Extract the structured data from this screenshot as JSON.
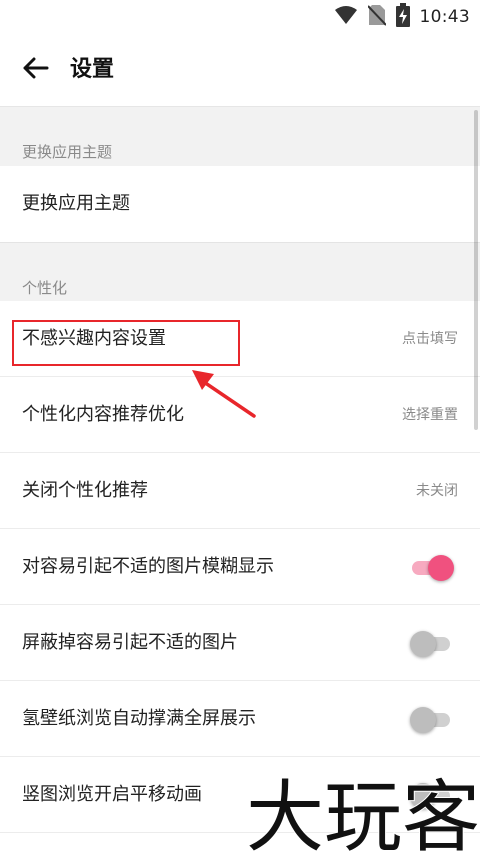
{
  "status_bar": {
    "time": "10:43",
    "icons": [
      "wifi-icon",
      "no-sim-icon",
      "battery-charging-icon"
    ]
  },
  "app_bar": {
    "title": "设置",
    "back_icon": "arrow-left-icon"
  },
  "sections": [
    {
      "header": "更换应用主题",
      "items": [
        {
          "label": "更换应用主题"
        }
      ]
    },
    {
      "header": "个性化",
      "items": [
        {
          "label": "不感兴趣内容设置",
          "value": "点击填写"
        },
        {
          "label": "个性化内容推荐优化",
          "value": "选择重置"
        },
        {
          "label": "关闭个性化推荐",
          "value": "未关闭"
        },
        {
          "label": "对容易引起不适的图片模糊显示",
          "toggle": true
        },
        {
          "label": "屏蔽掉容易引起不适的图片",
          "toggle": false
        },
        {
          "label": "氢壁纸浏览自动撑满全屏展示",
          "toggle": false
        },
        {
          "label": "竖图浏览开启平移动画",
          "toggle": false
        }
      ]
    }
  ],
  "annotation": {
    "color": "#e8262b"
  },
  "watermark": {
    "text": "大玩客"
  },
  "colors": {
    "accent": "#f0517f",
    "accent_track": "#f7aac0",
    "toggle_off": "#bdbdbd",
    "background": "#f2f2f2"
  }
}
